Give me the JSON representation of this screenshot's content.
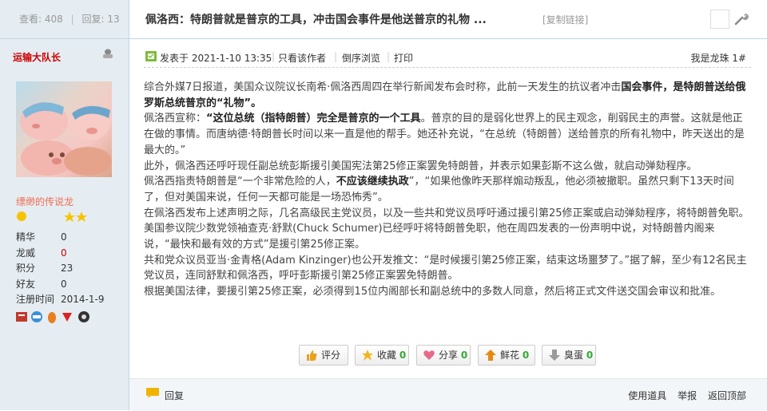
{
  "stats": {
    "views_label": "查看:",
    "views": "408",
    "replies_label": "回复:",
    "replies": "13"
  },
  "thread": {
    "title": "佩洛西：特朗普就是普京的工具，冲击国会事件是他送普京的礼物 ...",
    "copy_link": "[复制链接]"
  },
  "user": {
    "name": "运输大队长",
    "title": "缥缈的传说龙",
    "fields": [
      {
        "key": "精华",
        "value": "0"
      },
      {
        "key": "龙威",
        "value": "0"
      },
      {
        "key": "积分",
        "value": "23"
      },
      {
        "key": "好友",
        "value": "0"
      },
      {
        "key": "注册时间",
        "value": "2014-1-9"
      }
    ]
  },
  "post": {
    "posted": "发表于 2021-1-10 13:35",
    "only_author": "只看该作者",
    "reverse": "倒序浏览",
    "print": "打印",
    "author_tag": "我是龙珠",
    "floor": "1#",
    "paragraphs": [
      {
        "a": "综合外媒7日报道，美国众议院议长南希·佩洛西周四在举行新闻发布会时称，此前一天发生的抗议者冲击",
        "b": "国会事件，是特朗普送给俄罗斯总统普京的“礼物”。",
        "c": ""
      },
      {
        "a": "佩洛西宣称：",
        "b": "“这位总统（指特朗普）完全是普京的一个工具",
        "c": "。普京的目的是弱化世界上的民主观念，削弱民主的声誉。这就是他正在做的事情。而唐纳德·特朗普长时间以来一直是他的帮手。她还补充说，“在总统（特朗普）送给普京的所有礼物中，昨天送出的是最大的。”"
      },
      {
        "a": "此外，佩洛西还呼吁现任副总统彭斯援引美国宪法第25修正案罢免特朗普，并表示如果彭斯不这么做，就启动弹劾程序。",
        "b": "",
        "c": ""
      },
      {
        "a": "佩洛西指责特朗普是“一个非常危险的人，",
        "b": "不应该继续执政",
        "c": "”，“如果他像昨天那样煽动叛乱，他必须被撤职。虽然只剩下13天时间了，但对美国来说，任何一天都可能是一场恐怖秀”。"
      },
      {
        "a": "在佩洛西发布上述声明之际，几名高级民主党议员，以及一些共和党议员呼吁通过援引第25修正案或启动弹劾程序，将特朗普免职。美国参议院少数党领袖查克·舒默(Chuck Schumer)已经呼吁将特朗普免职，他在周四发表的一份声明中说，对特朗普内阁来说，“最快和最有效的方式”是援引第25修正案。",
        "b": "",
        "c": ""
      },
      {
        "a": "共和党众议员亚当·金青格(Adam Kinzinger)也公开发推文：“是时候援引第25修正案，结束这场噩梦了。”据了解，至少有12名民主党议员，连同舒默和佩洛西，呼吁彭斯援引第25修正案罢免特朗普。",
        "b": "",
        "c": ""
      },
      {
        "a": "根据美国法律，要援引第25修正案，必须得到15位内阁部长和副总统中的多数人同意，然后将正式文件送交国会审议和批准。",
        "b": "",
        "c": ""
      }
    ]
  },
  "actions": [
    {
      "label": "评分",
      "count": "",
      "icon": "thumb-up-icon"
    },
    {
      "label": "收藏",
      "count": "0",
      "icon": "star-icon"
    },
    {
      "label": "分享",
      "count": "0",
      "icon": "heart-icon"
    },
    {
      "label": "鲜花",
      "count": "0",
      "icon": "arrow-up-icon"
    },
    {
      "label": "臭蛋",
      "count": "0",
      "icon": "arrow-down-icon"
    }
  ],
  "footer": {
    "reply": "回复",
    "tools": "使用道具",
    "report": "举报",
    "top": "返回顶部"
  },
  "colors": {
    "sidebar_bg": "#e5edf2",
    "username": "#cc0000",
    "user_title": "#f26c4f",
    "count_green": "#33aa33"
  }
}
